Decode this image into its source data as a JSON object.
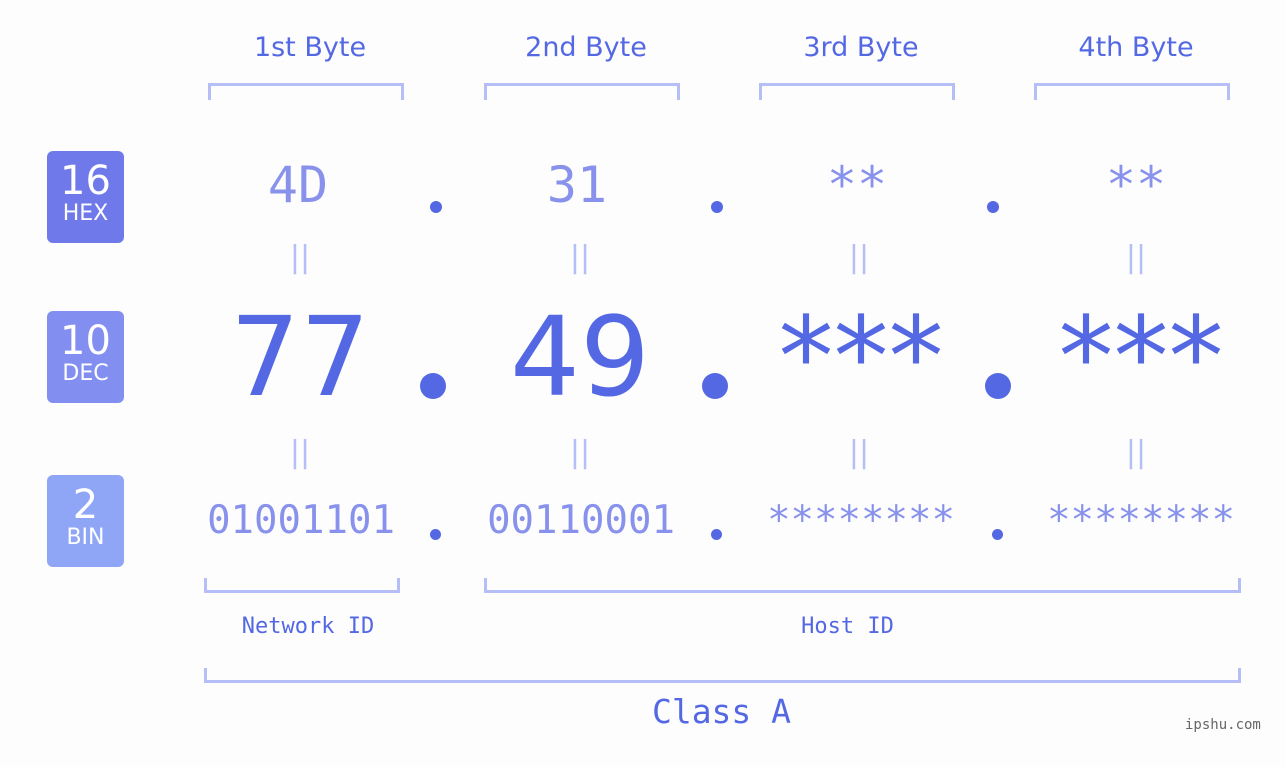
{
  "bytes": [
    {
      "label": "1st Byte",
      "hex": "4D",
      "dec": "77",
      "bin": "01001101"
    },
    {
      "label": "2nd Byte",
      "hex": "31",
      "dec": "49",
      "bin": "00110001"
    },
    {
      "label": "3rd Byte",
      "hex": "**",
      "dec": "***",
      "bin": "********"
    },
    {
      "label": "4th Byte",
      "hex": "**",
      "dec": "***",
      "bin": "********"
    }
  ],
  "badges": {
    "hex": {
      "num": "16",
      "label": "HEX",
      "color": "#7079ea"
    },
    "dec": {
      "num": "10",
      "label": "DEC",
      "color": "#838ff0"
    },
    "bin": {
      "num": "2",
      "label": "BIN",
      "color": "#8fa6f7"
    }
  },
  "equals_symbol": "=",
  "network_id_label": "Network ID",
  "host_id_label": "Host ID",
  "class_label": "Class A",
  "watermark": "ipshu.com",
  "colors": {
    "accent": "#5468e4",
    "light": "#8892ec",
    "bracket": "#b5bef7"
  }
}
